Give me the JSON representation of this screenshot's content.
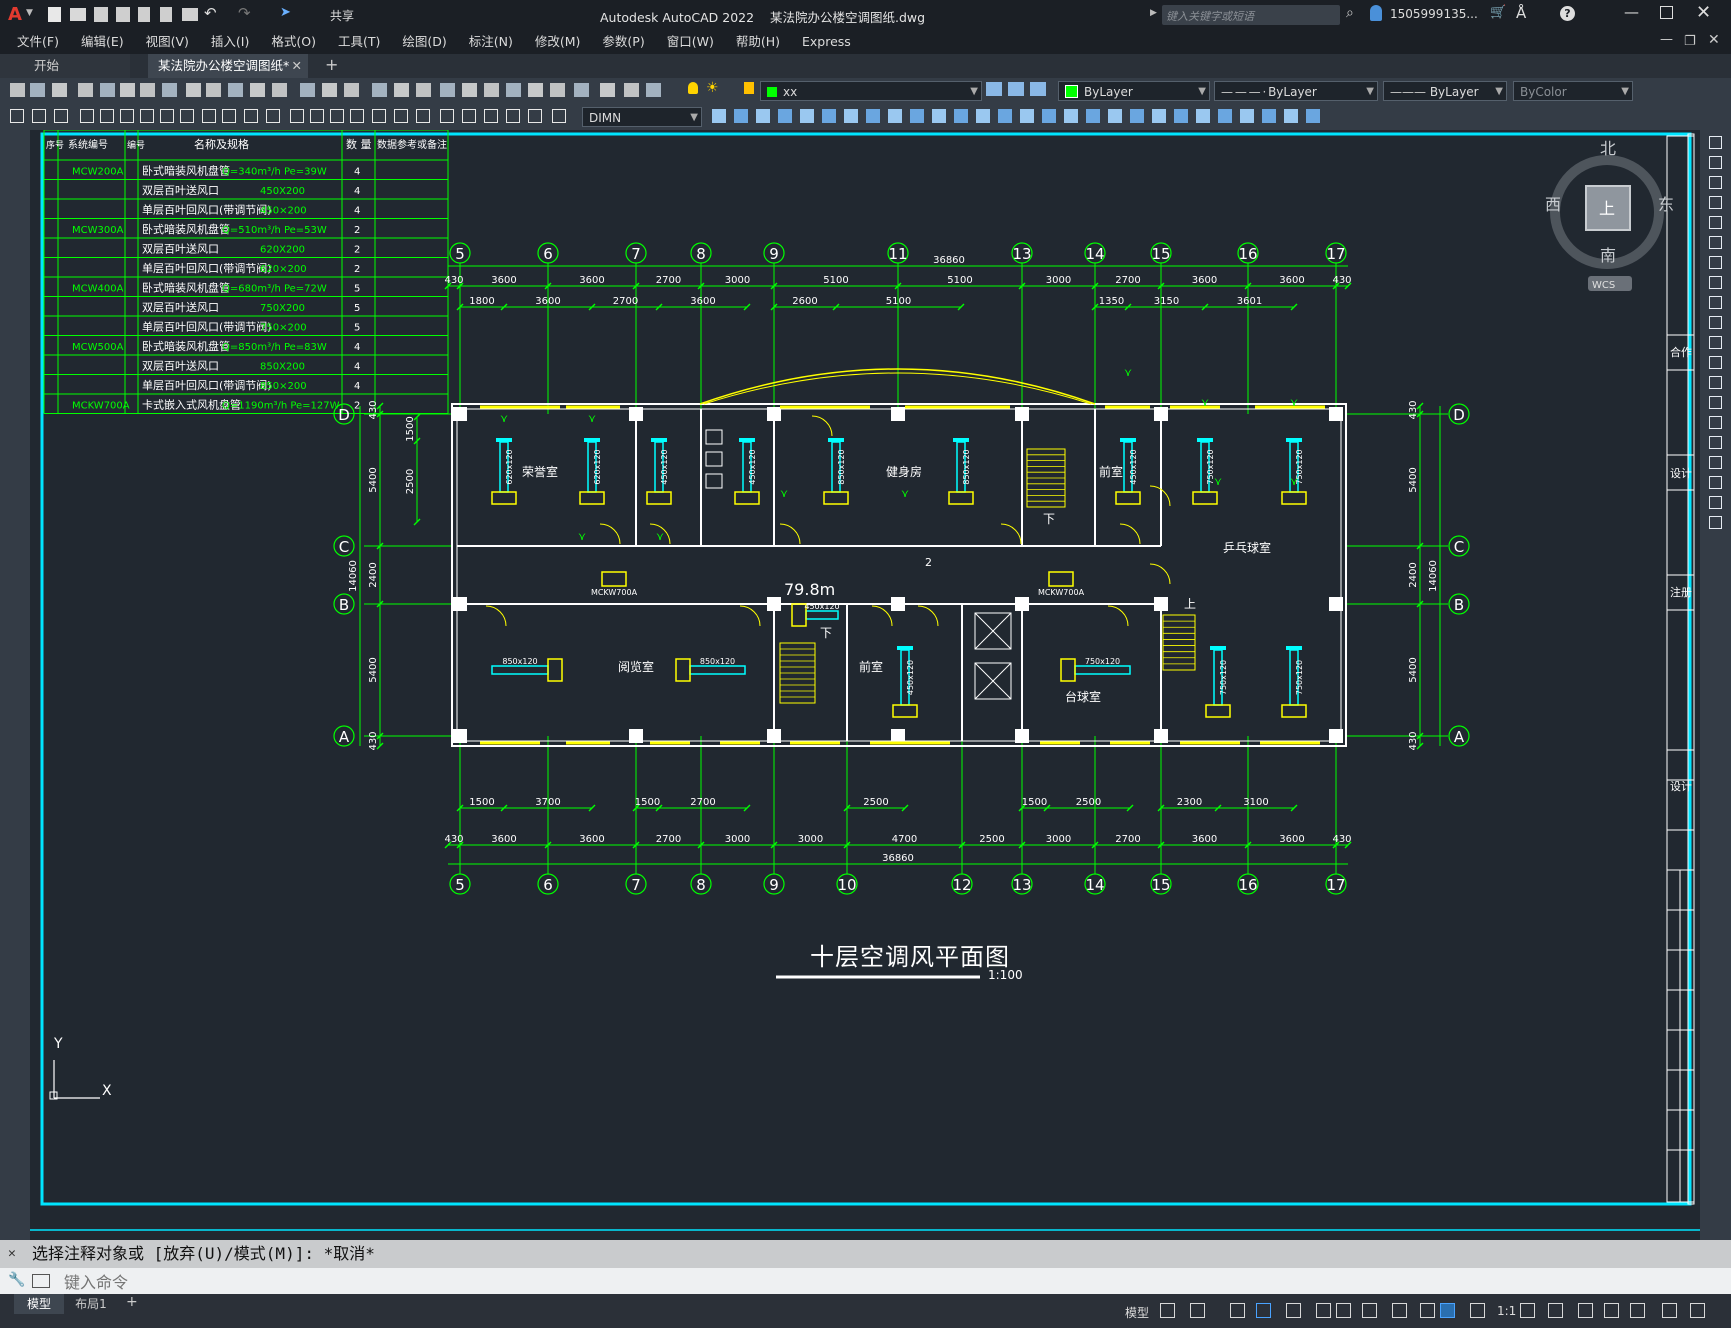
{
  "title": {
    "app": "Autodesk AutoCAD 2022",
    "file": "某法院办公楼空调图纸.dwg",
    "search_placeholder": "键入关键字或短语",
    "user": "1505999135...",
    "share": "共享"
  },
  "menu": [
    "文件(F)",
    "编辑(E)",
    "视图(V)",
    "插入(I)",
    "格式(O)",
    "工具(T)",
    "绘图(D)",
    "标注(N)",
    "修改(M)",
    "参数(P)",
    "窗口(W)",
    "帮助(H)",
    "Express"
  ],
  "tabs": {
    "start": "开始",
    "drawing": "某法院办公楼空调图纸*"
  },
  "props": {
    "layer": "xx",
    "color": "ByLayer",
    "linetype": "ByLayer",
    "lineweight": "ByLayer",
    "plotstyle": "ByColor",
    "dimstyle": "DIMN"
  },
  "viewcube": {
    "north": "北",
    "south": "南",
    "west": "西",
    "east": "东",
    "top": "上",
    "wcs": "WCS"
  },
  "table": {
    "headers": [
      "序号",
      "系统编号",
      "编号",
      "名称及规格",
      "数 量",
      "数据参考或备注"
    ],
    "rows": [
      {
        "sys": "MCW200A",
        "name": "卧式暗装风机盘管",
        "spec": "Q=340m³/h    Pe=39W",
        "qty": "4"
      },
      {
        "sys": "",
        "name": "双层百叶送风口",
        "spec": "450X200",
        "qty": "4"
      },
      {
        "sys": "",
        "name": "单层百叶回风口(带调节阀)",
        "spec": "450×200",
        "qty": "4"
      },
      {
        "sys": "MCW300A",
        "name": "卧式暗装风机盘管",
        "spec": "Q=510m³/h    Pe=53W",
        "qty": "2"
      },
      {
        "sys": "",
        "name": "双层百叶送风口",
        "spec": "620X200",
        "qty": "2"
      },
      {
        "sys": "",
        "name": "单层百叶回风口(带调节阀)",
        "spec": "620×200",
        "qty": "2"
      },
      {
        "sys": "MCW400A",
        "name": "卧式暗装风机盘管",
        "spec": "Q=680m³/h    Pe=72W",
        "qty": "5"
      },
      {
        "sys": "",
        "name": "双层百叶送风口",
        "spec": "750X200",
        "qty": "5"
      },
      {
        "sys": "",
        "name": "单层百叶回风口(带调节阀)",
        "spec": "750×200",
        "qty": "5"
      },
      {
        "sys": "MCW500A",
        "name": "卧式暗装风机盘管",
        "spec": "Q=850m³/h    Pe=83W",
        "qty": "4"
      },
      {
        "sys": "",
        "name": "双层百叶送风口",
        "spec": "850X200",
        "qty": "4"
      },
      {
        "sys": "",
        "name": "单层百叶回风口(带调节阀)",
        "spec": "850×200",
        "qty": "4"
      },
      {
        "sys": "MCKW700A",
        "name": "卡式嵌入式风机盘管",
        "spec": "Q=1190m³/h    Pe=127W",
        "qty": "2"
      }
    ]
  },
  "plan": {
    "title": "十层空调风平面图",
    "scale": "1:100",
    "axes_top": [
      "5",
      "6",
      "7",
      "8",
      "9",
      "11",
      "13",
      "14",
      "15",
      "16",
      "17"
    ],
    "axes_bottom": [
      "5",
      "6",
      "7",
      "8",
      "9",
      "10",
      "12",
      "13",
      "14",
      "15",
      "16",
      "17"
    ],
    "axes_side": [
      "D",
      "C",
      "B",
      "A"
    ],
    "total_dim": "36860",
    "top_dims": [
      "430",
      "3600",
      "3600",
      "2700",
      "3000",
      "5100",
      "5100",
      "3000",
      "2700",
      "3600",
      "3600",
      "430"
    ],
    "top_dims2": [
      "1800",
      "3600",
      "2700",
      "3600",
      "2600",
      "5100",
      "1350",
      "3150",
      "3601"
    ],
    "bottom_dims": [
      "430",
      "3600",
      "3600",
      "2700",
      "3000",
      "3000",
      "4700",
      "2500",
      "3000",
      "2700",
      "3600",
      "3600",
      "430"
    ],
    "bottom_dims2": [
      "1500",
      "3700",
      "1500",
      "2700",
      "2500",
      "1500",
      "2500",
      "2300",
      "3100"
    ],
    "left_dims": [
      "430",
      "5400",
      "2400",
      "5400",
      "430"
    ],
    "left_dims2": [
      "1500",
      "2500"
    ],
    "side_total": "14060",
    "rooms": [
      "荣誉室",
      "健身房",
      "前室",
      "乒乓球室",
      "阅览室",
      "前室",
      "台球室"
    ],
    "labels": {
      "corridor_no": "2",
      "mckw_left": "MCKW700A",
      "mckw_right": "MCKW700A",
      "area": "79.8m",
      "down": "下",
      "up": "上",
      "down2": "下"
    },
    "duct_tags": {
      "t450": "450x120",
      "t620": "620x120",
      "t850": "850x120",
      "t750": "750x120"
    }
  },
  "title_block": [
    "合作",
    "设计",
    "注册",
    "设计"
  ],
  "ucs": {
    "y": "Y",
    "x": "X"
  },
  "command": {
    "history": "选择注释对象或 [放弃(U)/模式(M)]: *取消*",
    "placeholder": "键入命令"
  },
  "status": {
    "model_tab": "模型",
    "layout_tab": "布局1",
    "model_btn": "模型",
    "scale": "1:1"
  },
  "colors": {
    "green": "#00ff00",
    "yellow": "#ffff00",
    "cyan": "#00ffff",
    "white": "#ffffff"
  }
}
